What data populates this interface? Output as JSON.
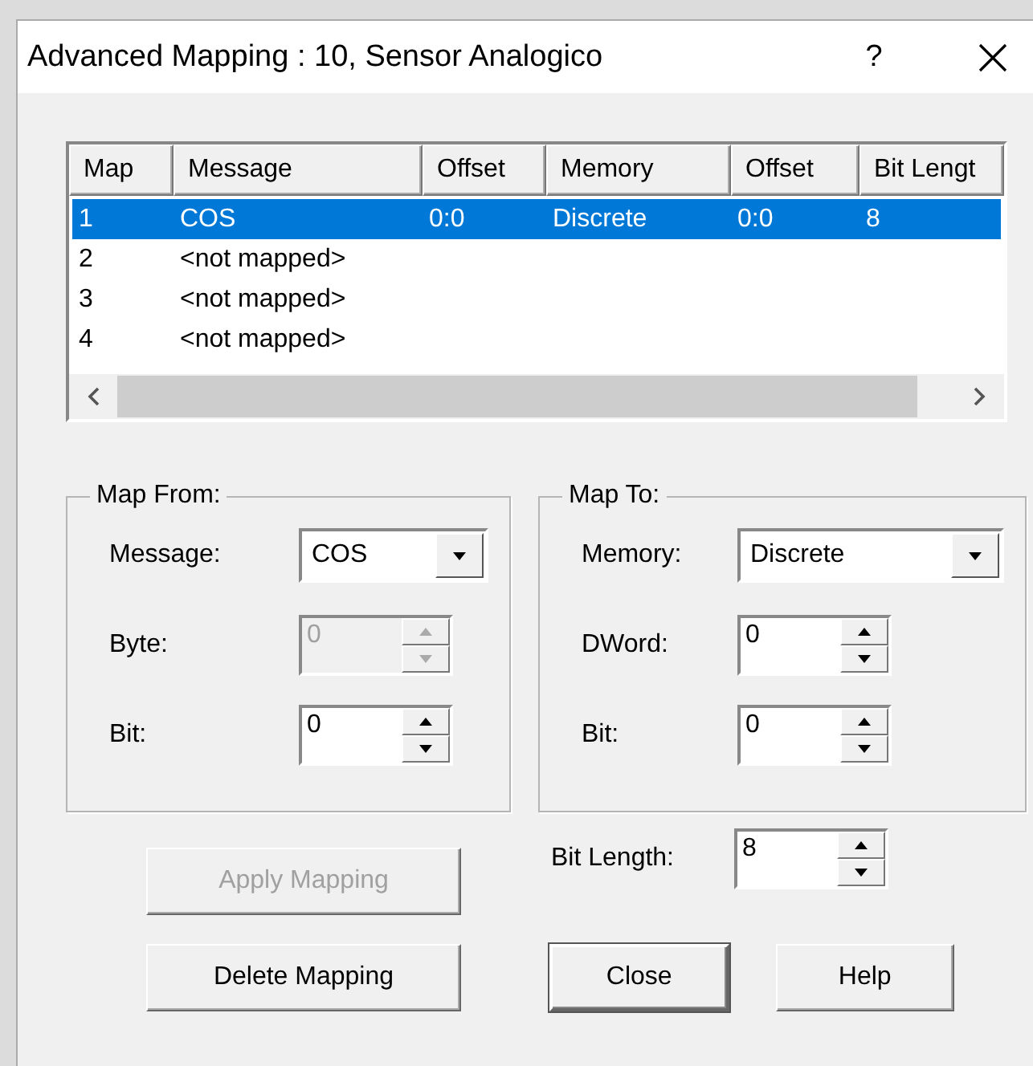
{
  "window": {
    "title": "Advanced Mapping : 10, Sensor Analogico",
    "help": "?"
  },
  "mappings": {
    "columns": [
      "Map",
      "Message",
      "Offset",
      "Memory",
      "Offset",
      "Bit Lengt"
    ],
    "rows": [
      {
        "cells": [
          "1",
          "COS",
          "0:0",
          "Discrete",
          "0:0",
          "8"
        ],
        "selected": true
      },
      {
        "cells": [
          "2",
          "<not mapped>",
          "",
          "",
          "",
          ""
        ],
        "selected": false
      },
      {
        "cells": [
          "3",
          "<not mapped>",
          "",
          "",
          "",
          ""
        ],
        "selected": false
      },
      {
        "cells": [
          "4",
          "<not mapped>",
          "",
          "",
          "",
          ""
        ],
        "selected": false
      }
    ]
  },
  "map_from": {
    "title": "Map From:",
    "fields": [
      {
        "kind": "combo",
        "label": "Message:",
        "value": "COS",
        "disabled": false
      },
      {
        "kind": "spin",
        "label": "Byte:",
        "value": "0",
        "disabled": true
      },
      {
        "kind": "spin",
        "label": "Bit:",
        "value": "0",
        "disabled": false
      }
    ]
  },
  "map_to": {
    "title": "Map To:",
    "fields": [
      {
        "kind": "combo",
        "label": "Memory:",
        "value": "Discrete",
        "disabled": false
      },
      {
        "kind": "spin",
        "label": "DWord:",
        "value": "0",
        "disabled": false
      },
      {
        "kind": "spin",
        "label": "Bit:",
        "value": "0",
        "disabled": false
      }
    ]
  },
  "bit_length": {
    "label": "Bit Length:",
    "value": "8",
    "disabled": false
  },
  "buttons": [
    {
      "label": "Apply Mapping",
      "disabled": true,
      "default": false
    },
    {
      "label": "Delete Mapping",
      "disabled": false,
      "default": false
    },
    {
      "label": "Close",
      "disabled": false,
      "default": true
    },
    {
      "label": "Help",
      "disabled": false,
      "default": false
    }
  ]
}
